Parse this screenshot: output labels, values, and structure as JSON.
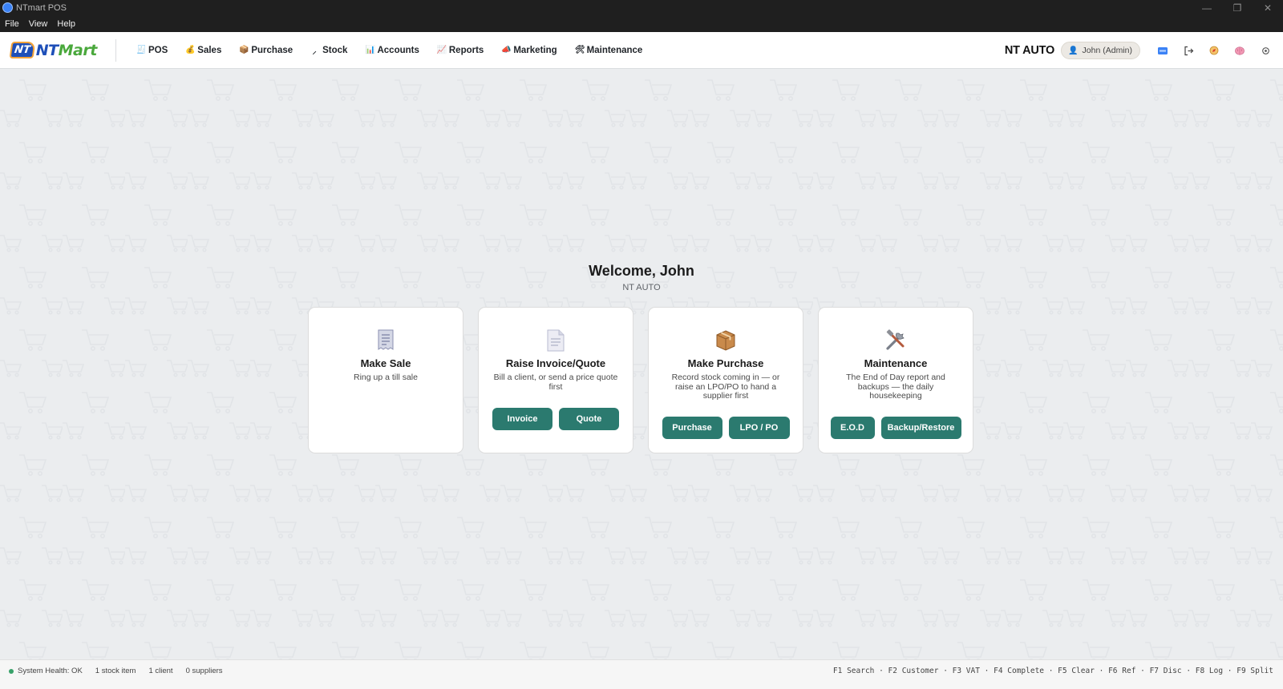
{
  "window": {
    "title": "NTmart POS",
    "controls": [
      "—",
      "❐",
      "✕"
    ]
  },
  "menu": [
    "File",
    "View",
    "Help"
  ],
  "logo": {
    "badge": "NT",
    "brand_nt": "NT",
    "brand_mart": "Mart"
  },
  "nav": [
    {
      "label": "POS",
      "icon": "receipt-icon",
      "glyph": "🧾"
    },
    {
      "label": "Sales",
      "icon": "money-bag-icon",
      "glyph": "💰"
    },
    {
      "label": "Purchase",
      "icon": "package-icon",
      "glyph": "📦"
    },
    {
      "label": "Stock",
      "icon": "broom-icon",
      "glyph": "⸝"
    },
    {
      "label": "Accounts",
      "icon": "bar-chart-icon",
      "glyph": "📊"
    },
    {
      "label": "Reports",
      "icon": "line-chart-icon",
      "glyph": "📈"
    },
    {
      "label": "Marketing",
      "icon": "megaphone-icon",
      "glyph": "📣"
    },
    {
      "label": "Maintenance",
      "icon": "tools-icon",
      "glyph": "🛠"
    }
  ],
  "header": {
    "company": "NT AUTO",
    "user": "John (Admin)"
  },
  "welcome": {
    "title": "Welcome, John",
    "subtitle": "NT AUTO"
  },
  "cards": [
    {
      "title": "Make Sale",
      "desc": "Ring up a till sale",
      "icon": "receipt-icon",
      "buttons": []
    },
    {
      "title": "Raise Invoice/Quote",
      "desc": "Bill a client, or send a price quote first",
      "icon": "document-icon",
      "buttons": [
        "Invoice",
        "Quote"
      ]
    },
    {
      "title": "Make Purchase",
      "desc": "Record stock coming in — or raise an LPO/PO to hand a supplier first",
      "icon": "package-icon",
      "buttons": [
        "Purchase",
        "LPO / PO"
      ]
    },
    {
      "title": "Maintenance",
      "desc": "The End of Day report and backups — the daily housekeeping",
      "icon": "tools-icon",
      "buttons": [
        "E.O.D",
        "Backup/Restore"
      ]
    }
  ],
  "status": {
    "health": "System Health: OK",
    "stock": "1 stock item",
    "clients": "1 client",
    "suppliers": "0 suppliers",
    "shortcuts": "F1 Search · F2 Customer · F3 VAT · F4 Complete · F5 Clear · F6 Ref · F7 Disc · F8 Log · F9 Split"
  },
  "colors": {
    "accent": "#2b7a6f",
    "brand_blue": "#1e4fb8",
    "brand_green": "#4aa83c",
    "titlebar": "#1f1f1f",
    "background": "#ebedef"
  }
}
